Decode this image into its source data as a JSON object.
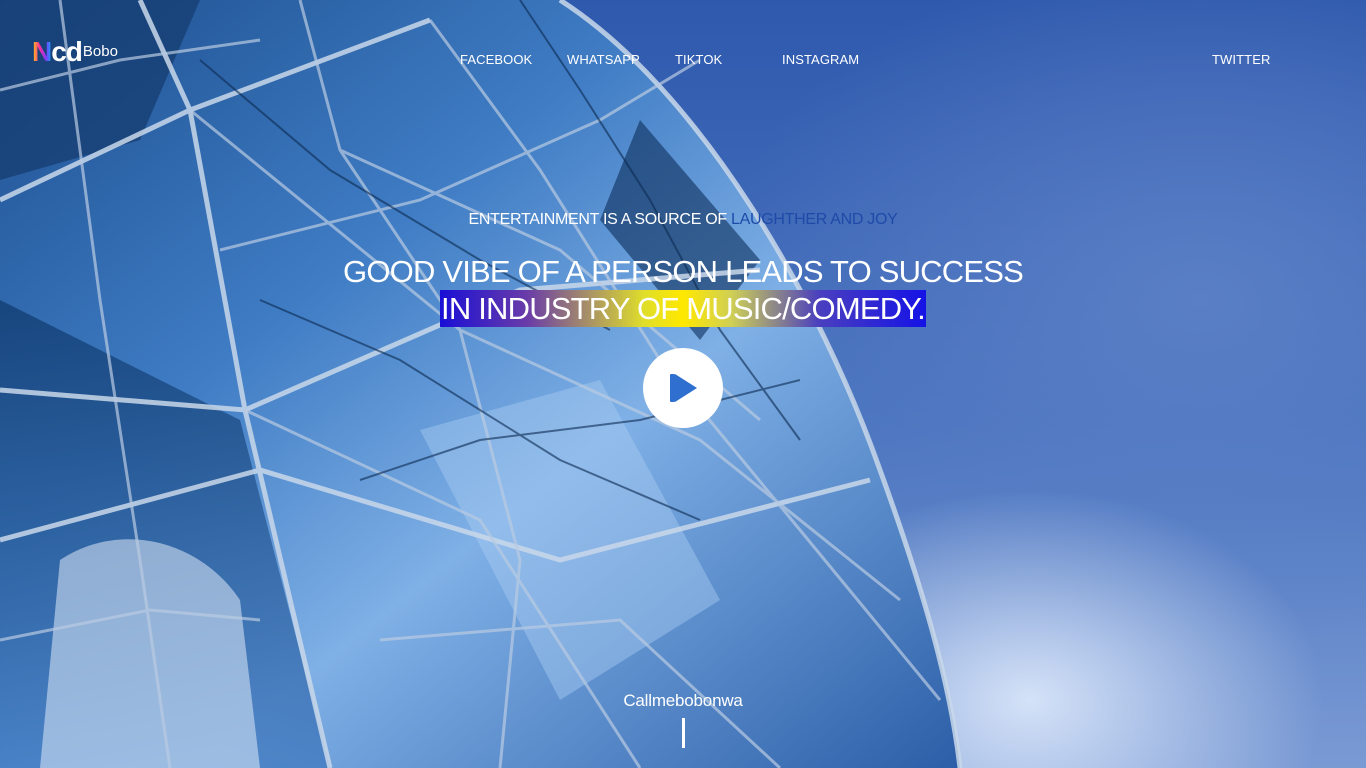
{
  "header": {
    "logo_mark_n": "N",
    "logo_mark_cd": "cd",
    "logo_text": "Bobo",
    "nav": [
      {
        "label": "FACEBOOK"
      },
      {
        "label": "WHATSAPP"
      },
      {
        "label": "TIKTOK"
      },
      {
        "label": "INSTAGRAM"
      },
      {
        "label": "TWITTER"
      }
    ]
  },
  "hero": {
    "tagline_prefix": "ENTERTAINMENT IS A SOURCE OF",
    "tagline_accent": "LAUGHTHER AND JOY",
    "headline_line1": "GOOD VIBE OF A PERSON LEADS TO SUCCESS",
    "headline_line2": "IN INDUSTRY OF MUSIC/COMEDY.",
    "play_icon": "play-icon"
  },
  "footer": {
    "handle": "Callmebobonwa"
  },
  "colors": {
    "accent_text": "#1f4aa8",
    "sky": "#4a74bf",
    "play_icon": "#2f6fd0"
  }
}
